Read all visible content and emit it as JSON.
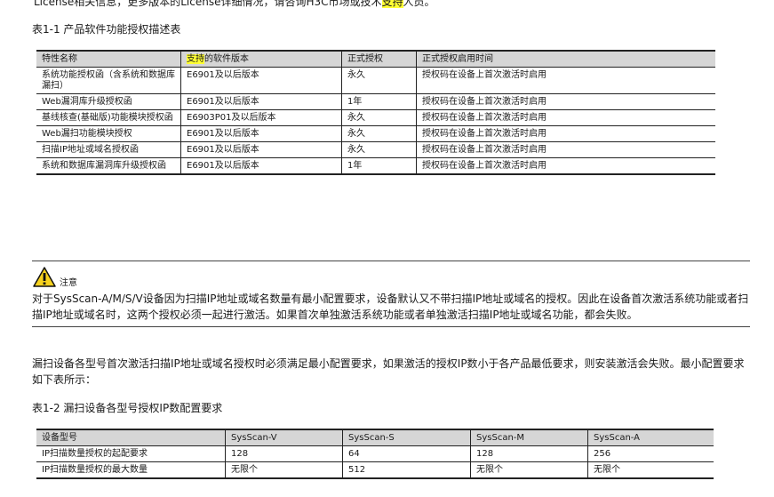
{
  "top_text": {
    "before": "License相关信息，更多版本的License详细情况，请咨询H3C市场或技术",
    "highlight": "支持",
    "after": "人员。"
  },
  "table1": {
    "caption": "表1-1 产品软件功能授权描述表",
    "headers": [
      {
        "highlight": "",
        "text": "特性名称"
      },
      {
        "highlight": "支持",
        "text": "的软件版本"
      },
      {
        "highlight": "",
        "text": "正式授权"
      },
      {
        "highlight": "",
        "text": "正式授权启用时间"
      }
    ],
    "rows": [
      [
        "系统功能授权函（含系统和数据库漏扫）",
        "E6901及以后版本",
        "永久",
        "授权码在设备上首次激活时启用"
      ],
      [
        "Web漏洞库升级授权函",
        "E6901及以后版本",
        "1年",
        "授权码在设备上首次激活时启用"
      ],
      [
        "基线核查(基础版)功能模块授权函",
        "E6903P01及以后版本",
        "永久",
        "授权码在设备上首次激活时启用"
      ],
      [
        "Web漏扫功能模块授权",
        "E6901及以后版本",
        "永久",
        "授权码在设备上首次激活时启用"
      ],
      [
        "扫描IP地址或域名授权函",
        "E6901及以后版本",
        "永久",
        "授权码在设备上首次激活时启用"
      ],
      [
        "系统和数据库漏洞库升级授权函",
        "E6901及以后版本",
        "1年",
        "授权码在设备上首次激活时启用"
      ]
    ]
  },
  "note": {
    "icon": "warning-triangle-icon",
    "label": "注意",
    "text": "对于SysScan-A/M/S/V设备因为扫描IP地址或域名数量有最小配置要求，设备默认又不带扫描IP地址或域名的授权。因此在设备首次激活系统功能或者扫描IP地址或域名时，这两个授权必须一起进行激活。如果首次单独激活系统功能或者单独激活扫描IP地址或域名功能，都会失败。"
  },
  "paragraph": "漏扫设备各型号首次激活扫描IP地址或域名授权时必须满足最小配置要求，如果激活的授权IP数小于各产品最低要求，则安装激活会失败。最小配置要求如下表所示：",
  "table2": {
    "caption": "表1-2 漏扫设备各型号授权IP数配置要求",
    "headers": [
      "设备型号",
      "SysScan-V",
      "SysScan-S",
      "SysScan-M",
      "SysScan-A"
    ],
    "rows": [
      [
        "IP扫描数量授权的起配要求",
        "128",
        "64",
        "128",
        "256"
      ],
      [
        "IP扫描数量授权的最大数量",
        "无限个",
        "512",
        "无限个",
        "无限个"
      ]
    ]
  },
  "colors": {
    "highlight": "#ffff33",
    "header_bg": "#d6d6d6",
    "warning_yellow": "#f7d21e"
  }
}
